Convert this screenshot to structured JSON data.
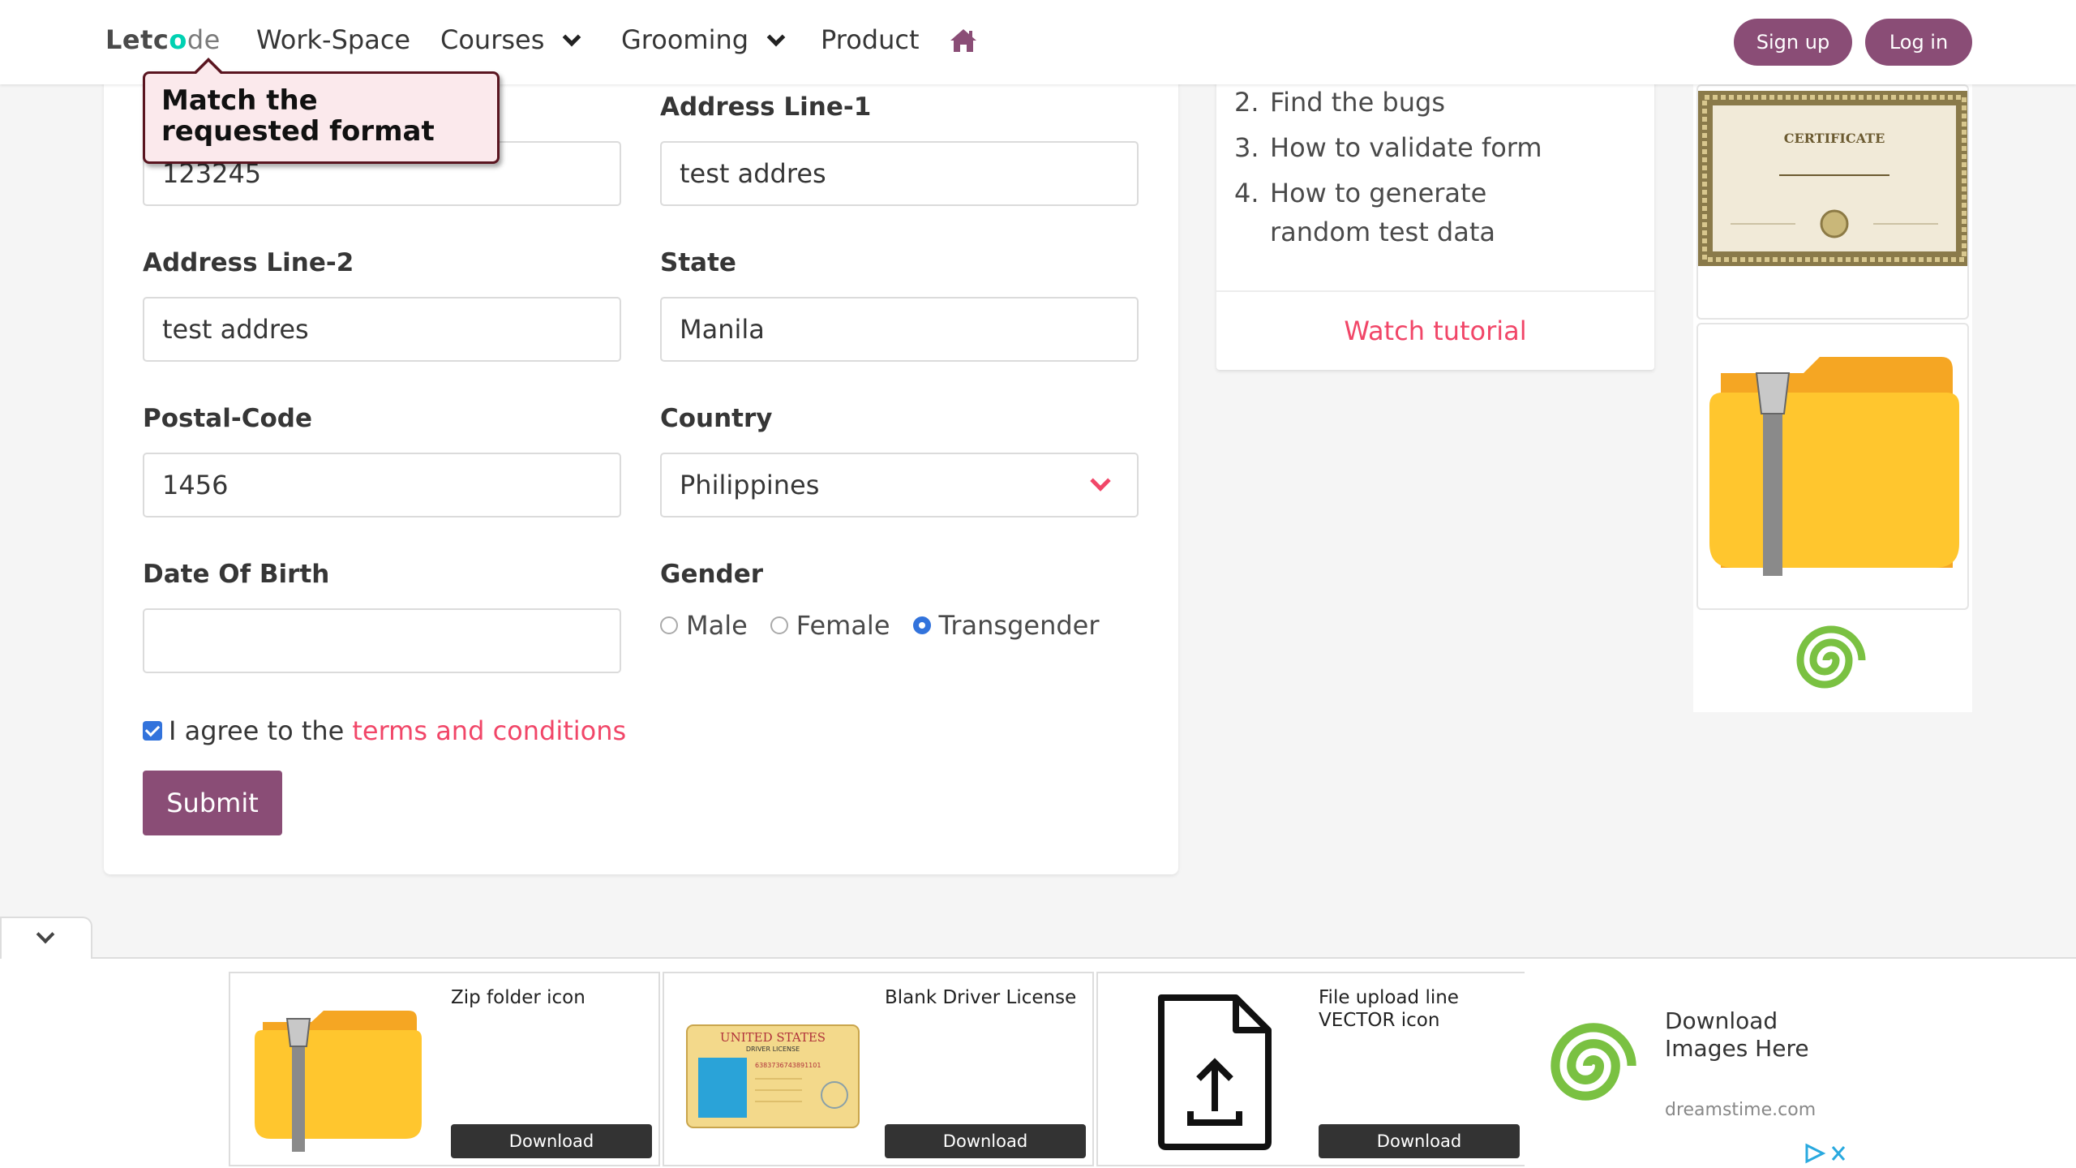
{
  "nav": {
    "logo": {
      "a": "Letc",
      "o": "o",
      "b": "de"
    },
    "items": [
      "Work-Space",
      "Courses",
      "Grooming",
      "Product"
    ],
    "signup": "Sign up",
    "login": "Log in"
  },
  "tooltip": {
    "text": "Match the requested format"
  },
  "form": {
    "field1": {
      "value": "123245"
    },
    "address1": {
      "label": "Address Line-1",
      "value": "test addres"
    },
    "address2": {
      "label": "Address Line-2",
      "value": "test addres"
    },
    "state": {
      "label": "State",
      "value": "Manila"
    },
    "postal": {
      "label": "Postal-Code",
      "value": "1456"
    },
    "country": {
      "label": "Country",
      "value": "Philippines"
    },
    "dob": {
      "label": "Date Of Birth",
      "value": ""
    },
    "gender": {
      "label": "Gender",
      "options": [
        "Male",
        "Female",
        "Transgender"
      ],
      "selected": "Transgender"
    },
    "agree": {
      "prefix": "I agree to the",
      "link": "terms and conditions",
      "checked": true
    },
    "submit": "Submit"
  },
  "tutorial": {
    "items": [
      {
        "num": "2.",
        "text": "Find the bugs"
      },
      {
        "num": "3.",
        "text": "How to validate form"
      },
      {
        "num": "4.",
        "text": "How to generate random test data"
      }
    ],
    "watch": "Watch tutorial"
  },
  "side_ads": {
    "certificate_text": "CERTIFICATE"
  },
  "bottom_ads": [
    {
      "title": "Zip folder icon",
      "button": "Download"
    },
    {
      "title": "Blank Driver License",
      "button": "Download",
      "image_text": {
        "headline": "UNITED STATES",
        "sub": "DRIVER LICENSE",
        "num": "6383736743891101"
      }
    },
    {
      "title": "File upload line VECTOR icon",
      "button": "Download"
    }
  ],
  "promo": {
    "title": "Download Images Here",
    "site": "dreamstime.com"
  },
  "colors": {
    "primary": "#8a4d76",
    "link": "#f14668",
    "radio": "#3273dc"
  }
}
